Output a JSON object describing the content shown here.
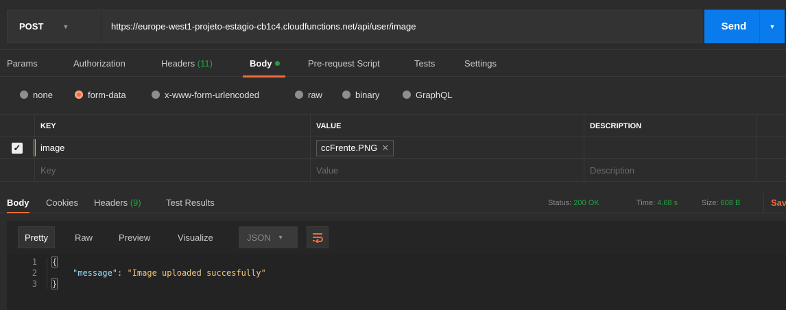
{
  "request": {
    "method": "POST",
    "url": "https://europe-west1-projeto-estagio-cb1c4.cloudfunctions.net/api/user/image",
    "send_label": "Send"
  },
  "request_tabs": [
    "Params",
    "Authorization",
    "Headers",
    "(11)",
    "Body",
    "Pre-request Script",
    "Tests",
    "Settings"
  ],
  "body_types": [
    "none",
    "form-data",
    "x-www-form-urlencoded",
    "raw",
    "binary",
    "GraphQL"
  ],
  "params_table": {
    "headers": [
      "KEY",
      "VALUE",
      "DESCRIPTION"
    ],
    "row": {
      "key": "image",
      "file": "ccFrente.PNG"
    },
    "placeholders": [
      "Key",
      "Value",
      "Description"
    ]
  },
  "response": {
    "tabs": [
      "Body",
      "Cookies",
      "Headers",
      "(9)",
      "Test Results"
    ],
    "status_label": "Status:",
    "status_value": "200 OK",
    "time_label": "Time:",
    "time_value": "4.68 s",
    "size_label": "Size:",
    "size_value": "608 B",
    "save_label": "Save"
  },
  "format_bar": {
    "buttons": [
      "Pretty",
      "Raw",
      "Preview",
      "Visualize"
    ],
    "json_select": "JSON"
  },
  "code": {
    "line_numbers": [
      "1",
      "2",
      "3"
    ],
    "open_brace": "{",
    "key": "\"message\"",
    "colon": ": ",
    "value": "\"Image uploaded succesfully\"",
    "close_brace": "}"
  }
}
